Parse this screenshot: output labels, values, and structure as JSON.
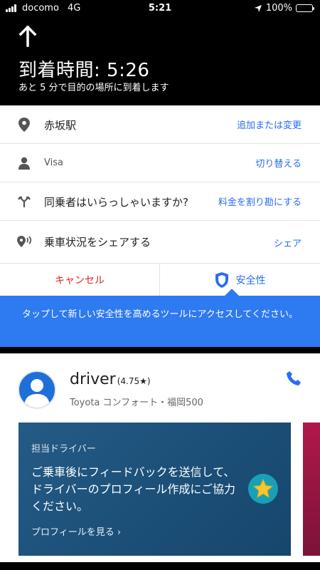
{
  "status_bar": {
    "carrier": "docomo",
    "network": "4G",
    "time": "5:21",
    "battery": "100%",
    "battery_fraction": 1.0
  },
  "navigation": {
    "eta_title": "到着時間: 5:26",
    "eta_subtitle": "あと 5 分で目的の場所に到着します",
    "direction_icon": "arrow-up-icon"
  },
  "trip": {
    "destination": {
      "icon": "location-pin-icon",
      "label": "赤坂駅",
      "action": "追加または変更"
    },
    "payment": {
      "icon": "person-icon",
      "label": "Visa",
      "action": "切り替える"
    },
    "split": {
      "icon": "split-arrow-icon",
      "label": "同乗者はいらっしゃいますか?",
      "action": "料金を割り勘にする"
    },
    "share": {
      "icon": "share-status-icon",
      "label": "乗車状況をシェアする",
      "action": "シェア"
    },
    "cancel_label": "キャンセル",
    "safety_label": "安全性",
    "safety_icon": "shield-icon"
  },
  "tooltip": {
    "text": "タップして新しい安全性を高めるツールにアクセスしてください。"
  },
  "driver": {
    "name": "driver",
    "rating": "(4.75★)",
    "vehicle": "Toyota コンフォート・福岡500",
    "phone_icon": "phone-icon"
  },
  "feedback_card": {
    "kicker": "担当ドライバー",
    "message": "ご乗車後にフィードバックを送信して、ドライバーのプロフィール作成にご協力ください。",
    "link": "プロフィールを見る ›",
    "icon": "star-icon"
  },
  "colors": {
    "accent_blue": "#276ef1",
    "cancel_red": "#e1251b",
    "tooltip_blue": "#2d7af1",
    "card_blue": "#1b4f78"
  }
}
